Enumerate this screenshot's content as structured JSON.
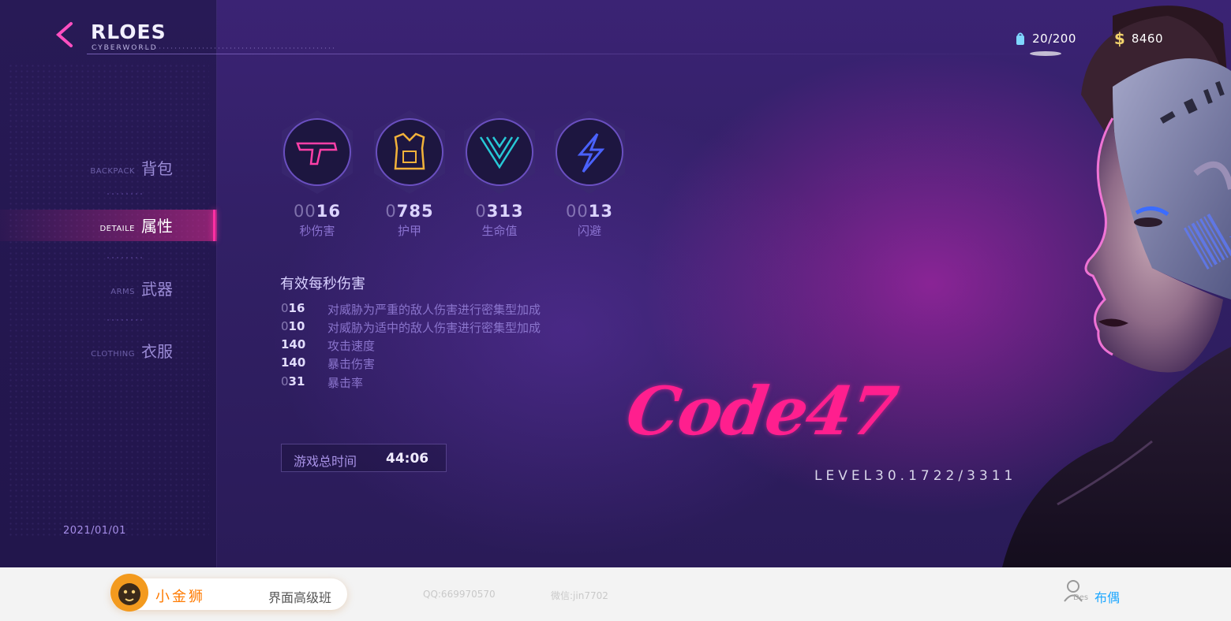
{
  "header": {
    "title": "RLOES",
    "subtitle": "CYBERWORLD",
    "resources": [
      {
        "icon": "backpack-capacity-icon",
        "value": "20/200"
      },
      {
        "icon": "dollar-icon",
        "symbol": "$",
        "value": "8460"
      }
    ]
  },
  "nav": [
    {
      "en": "BACKPACK",
      "zh": "背包",
      "active": false
    },
    {
      "en": "DETAILE",
      "zh": "属性",
      "active": true
    },
    {
      "en": "ARMS",
      "zh": "武器",
      "active": false
    },
    {
      "en": "CLOTHING",
      "zh": "衣服",
      "active": false
    }
  ],
  "stats": [
    {
      "pad": "00",
      "value": "16",
      "label": "秒伤害",
      "icon": "pistol-icon",
      "color": "#ff3fa8"
    },
    {
      "pad": "0",
      "value": "785",
      "label": "护甲",
      "icon": "armor-vest-icon",
      "color": "#f2b23a"
    },
    {
      "pad": "0",
      "value": "313",
      "label": "生命值",
      "icon": "shield-chevron-icon",
      "color": "#27c8d6"
    },
    {
      "pad": "00",
      "value": "13",
      "label": "闪避",
      "icon": "lightning-icon",
      "color": "#4a62ff"
    }
  ],
  "dps": {
    "title": "有效每秒伤害",
    "rows": [
      {
        "pad": "0",
        "value": "16",
        "desc": "对威胁为严重的敌人伤害进行密集型加成"
      },
      {
        "pad": "0",
        "value": "10",
        "desc": "对威胁为适中的敌人伤害进行密集型加成"
      },
      {
        "pad": "",
        "value": "140",
        "desc": "攻击速度"
      },
      {
        "pad": "",
        "value": "140",
        "desc": "暴击伤害"
      },
      {
        "pad": "0",
        "value": "31",
        "desc": "暴击率"
      }
    ]
  },
  "total_time": {
    "label": "游戏总时间",
    "value": "44:06"
  },
  "date": "2021/01/01",
  "hero": {
    "name": "Code47",
    "level": "LEVEL30.1722/3311"
  },
  "footer": {
    "brand_name": "小金狮",
    "brand_course": "界面高级班",
    "qq": "QQ:669970570",
    "wechat": "微信:jin7702",
    "designer_tag": "Des",
    "designer_name": "布偶"
  }
}
